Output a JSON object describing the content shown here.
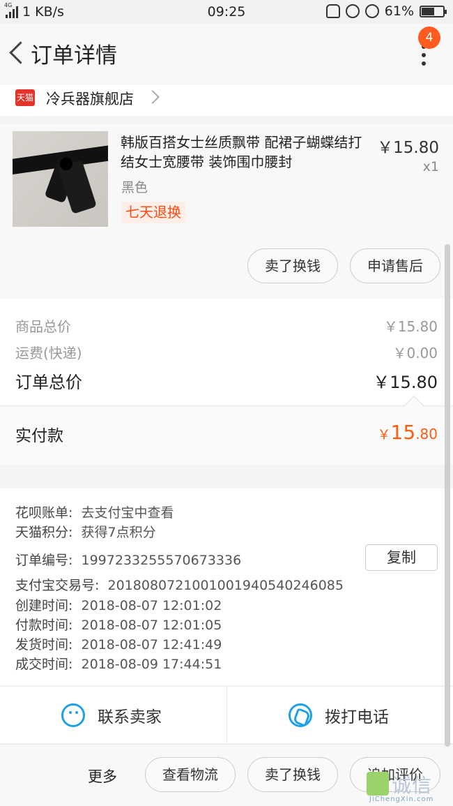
{
  "status_bar": {
    "network_tiny": "4G",
    "speed": "1 KB/s",
    "time": "09:25",
    "battery": "61%",
    "battery_level": 0.61
  },
  "header": {
    "title": "订单详情",
    "badge_count": "4"
  },
  "shop": {
    "platform_logo": "天猫",
    "name": "冷兵器旗舰店"
  },
  "product": {
    "title": "韩版百搭女士丝质飘带 配裙子蝴蝶结打结女士宽腰带 装饰围巾腰封",
    "price": "￥15.80",
    "quantity": "x1",
    "color": "黑色",
    "tag": "七天退换",
    "actions": [
      "卖了换钱",
      "申请售后"
    ]
  },
  "summary": {
    "rows": [
      {
        "label": "商品总价",
        "value": "￥15.80"
      },
      {
        "label": "运费(快递)",
        "value": "￥0.00"
      }
    ],
    "total_label": "订单总价",
    "total_value": "￥15.80",
    "paid_label": "实付款",
    "paid_currency": "￥",
    "paid_int": "15",
    "paid_dec": ".80"
  },
  "info": {
    "huabei_label": "花呗账单:",
    "huabei_value": "去支付宝中查看",
    "points_label": "天猫积分:",
    "points_value": "获得7点积分",
    "order_no_label": "订单编号:",
    "order_no": "1997233255570673336",
    "copy_label": "复制",
    "alipay_label": "支付宝交易号:",
    "alipay_no": "2018080721001001940540246085",
    "created_label": "创建时间:",
    "created": "2018-08-07 12:01:02",
    "paid_time_label": "付款时间:",
    "paid_time": "2018-08-07 12:01:05",
    "shipped_label": "发货时间:",
    "shipped": "2018-08-07 12:41:49",
    "completed_label": "成交时间:",
    "completed": "2018-08-09 17:44:51"
  },
  "contact": {
    "seller": "联系卖家",
    "call": "拨打电话"
  },
  "bottom": {
    "more": "更多",
    "buttons": [
      "查看物流",
      "卖了换钱",
      "追加评价"
    ]
  },
  "watermark": {
    "text": "诚信",
    "url": "JiChengXin.com"
  },
  "colors": {
    "accent_orange": "#ff5a10",
    "tag_bg": "#fdeee8",
    "contact_blue": "#1fa0e8",
    "badge": "#ff5a1f",
    "tmall_red": "#e4332b"
  },
  "icons": [
    "signal-icon",
    "mute-icon",
    "rotation-lock-icon",
    "alarm-icon",
    "battery-icon",
    "back-icon",
    "more-dots-icon",
    "tmall-logo",
    "chevron-right-icon",
    "chat-icon",
    "phone-icon"
  ]
}
